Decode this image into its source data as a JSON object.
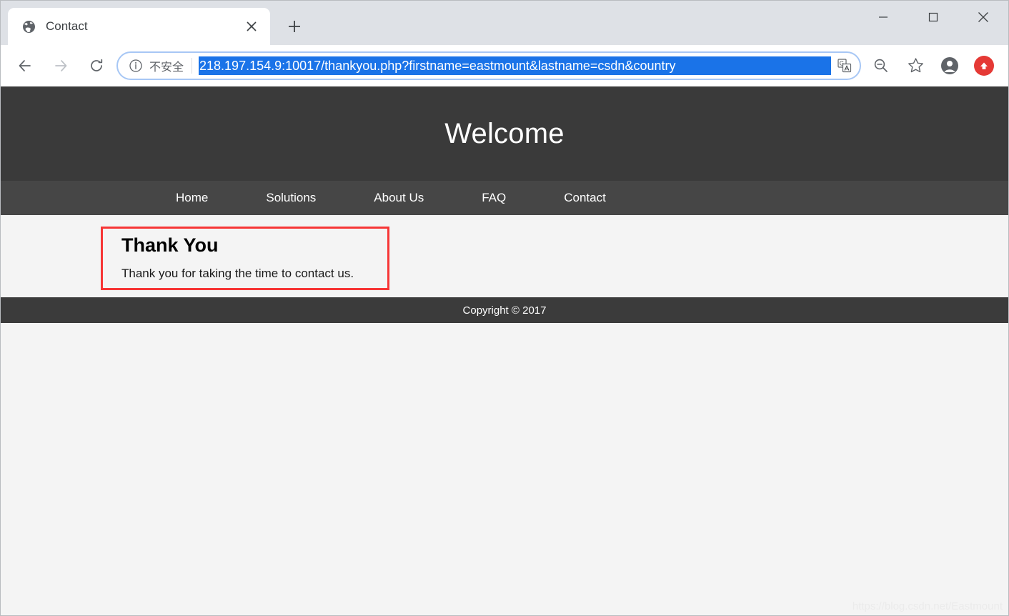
{
  "browser": {
    "tab": {
      "title": "Contact",
      "favicon": "globe-icon",
      "close_label": "×"
    },
    "new_tab_label": "+",
    "window_controls": {
      "minimize": "—",
      "maximize": "□",
      "close": "✕"
    },
    "nav": {
      "back": "back-arrow-icon",
      "forward": "forward-arrow-icon",
      "reload": "reload-icon"
    },
    "omnibox": {
      "security_icon": "info-circle-icon",
      "security_label": "不安全",
      "url": "218.197.154.9:10017/thankyou.php?firstname=eastmount&lastname=csdn&country",
      "url_selected": true,
      "selection_color": "#1a73e8",
      "border_color": "#a7c7f5"
    },
    "actions": {
      "translate": "translate-icon",
      "zoom_out": "zoom-out-icon",
      "bookmark": "star-icon",
      "profile": "profile-avatar-icon",
      "update": "update-arrow-icon",
      "update_color": "#e53935"
    }
  },
  "page": {
    "header": {
      "title": "Welcome",
      "bg": "#3a3a3a"
    },
    "nav": {
      "bg": "#464646",
      "items": [
        {
          "label": "Home"
        },
        {
          "label": "Solutions"
        },
        {
          "label": "About Us"
        },
        {
          "label": "FAQ"
        },
        {
          "label": "Contact"
        }
      ]
    },
    "main": {
      "bg": "#f4f4f4",
      "annotation_color": "#f73636",
      "heading": "Thank You",
      "body": "Thank you for taking the time to contact us."
    },
    "footer": {
      "text": "Copyright © 2017",
      "bg": "#3b3b3b"
    },
    "watermark": "https://blog.csdn.net/Eastmount"
  }
}
